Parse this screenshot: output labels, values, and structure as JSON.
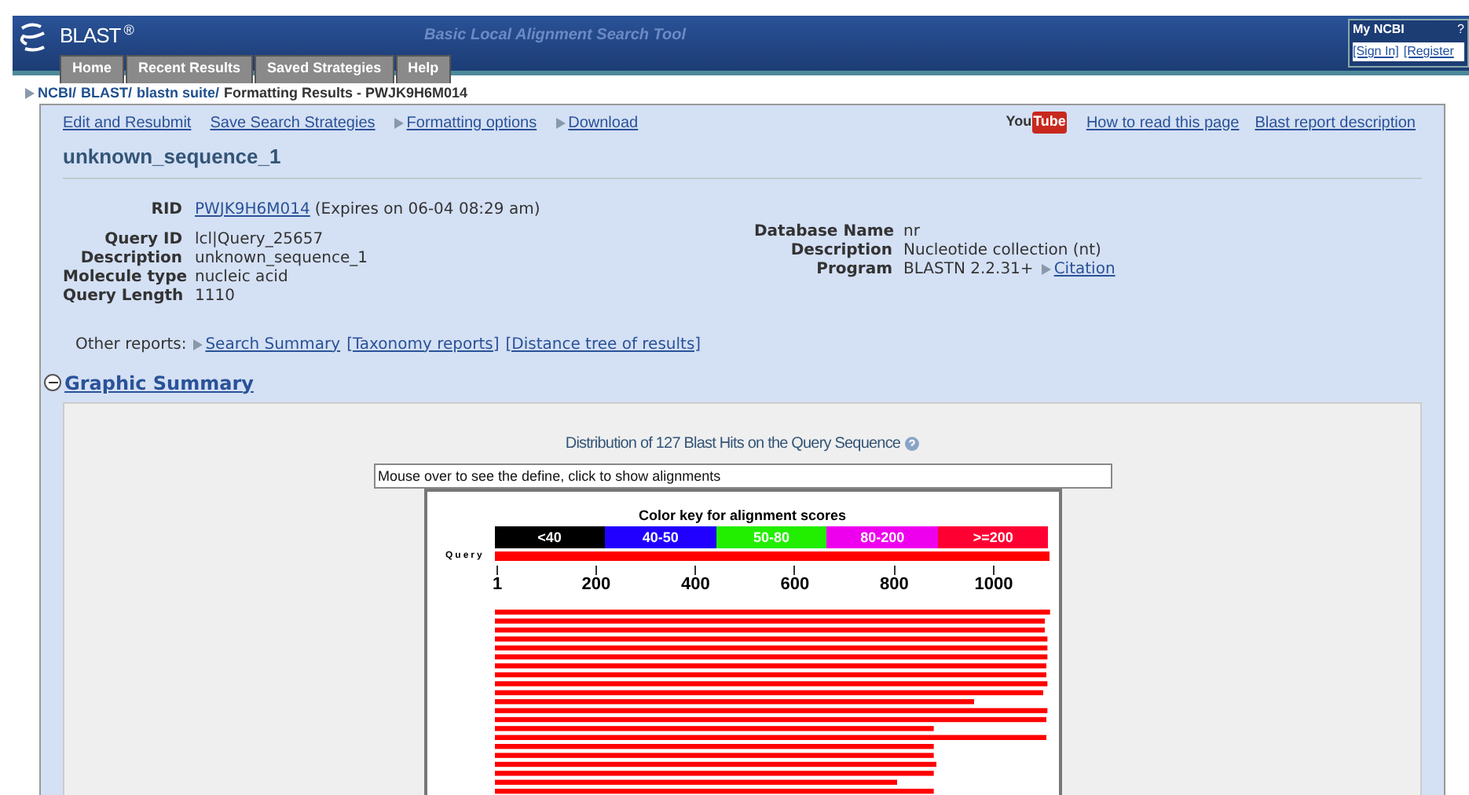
{
  "header": {
    "logo": "BLAST",
    "logo_mark": "®",
    "tagline": "Basic Local Alignment Search Tool",
    "tabs": [
      {
        "label": "Home"
      },
      {
        "label": "Recent Results"
      },
      {
        "label": "Saved Strategies"
      },
      {
        "label": "Help"
      }
    ],
    "my_ncbi": {
      "title": "My NCBI",
      "badge": "?",
      "sign_in": "[Sign In]",
      "register": "[Register"
    }
  },
  "breadcrumb": {
    "links": [
      "NCBI/",
      "BLAST/",
      "blastn suite/"
    ],
    "current": "Formatting Results - PWJK9H6M014"
  },
  "toolbar": {
    "links": [
      {
        "label": "Edit and Resubmit",
        "arrow": false
      },
      {
        "label": "Save Search Strategies",
        "arrow": false
      },
      {
        "label": "Formatting options",
        "arrow": true
      },
      {
        "label": "Download",
        "arrow": true
      }
    ],
    "youtube": {
      "you": "You",
      "tube": "Tube"
    },
    "help_links": [
      "How to read this page",
      "Blast report description"
    ]
  },
  "title": "unknown_sequence_1",
  "rid": {
    "label": "RID",
    "value": "PWJK9H6M014",
    "note": "(Expires on 06-04 08:29 am)"
  },
  "query_fields": [
    {
      "label": "Query ID",
      "value": "lcl|Query_25657"
    },
    {
      "label": "Description",
      "value": "unknown_sequence_1"
    },
    {
      "label": "Molecule type",
      "value": "nucleic acid"
    },
    {
      "label": "Query Length",
      "value": "1110"
    }
  ],
  "db_fields": [
    {
      "label": "Database Name",
      "value": "nr"
    },
    {
      "label": "Description",
      "value": "Nucleotide collection (nt)"
    },
    {
      "label": "Program",
      "value": "BLASTN 2.2.31+",
      "link": "Citation"
    }
  ],
  "other_reports": {
    "label": "Other reports:",
    "links": [
      {
        "label": "Search Summary",
        "arrow": true
      },
      {
        "label": "[Taxonomy reports]",
        "arrow": false
      },
      {
        "label": "[Distance tree of results]",
        "arrow": false
      }
    ]
  },
  "graphic_summary": {
    "title": "Graphic Summary",
    "expanded": true,
    "heading": "Distribution of 127 Blast Hits on the Query Sequence",
    "info_field": "Mouse over to see the define, click to show alignments",
    "key_title": "Color key for alignment scores",
    "key": [
      {
        "label": "<40",
        "color": "#000000"
      },
      {
        "label": "40-50",
        "color": "#2200ff"
      },
      {
        "label": "50-80",
        "color": "#22ee00"
      },
      {
        "label": "80-200",
        "color": "#ee00ee"
      },
      {
        "label": ">=200",
        "color": "#ff0033"
      }
    ],
    "query_label": "Query",
    "ticks": [
      "1",
      "200",
      "400",
      "600",
      "800",
      "1000"
    ]
  }
}
